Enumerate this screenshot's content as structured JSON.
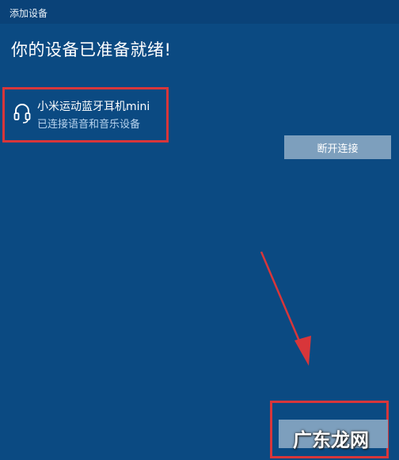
{
  "window": {
    "title": "添加设备"
  },
  "main": {
    "heading": "你的设备已准备就绪!",
    "device": {
      "name": "小米运动蓝牙耳机mini",
      "status": "已连接语音和音乐设备",
      "icon": "headset-icon"
    },
    "disconnect_label": "断开连接",
    "done_label": ""
  },
  "annotations": {
    "highlight_color": "#d8363a",
    "arrow_color": "#d8363a"
  },
  "watermark": "广东龙网"
}
